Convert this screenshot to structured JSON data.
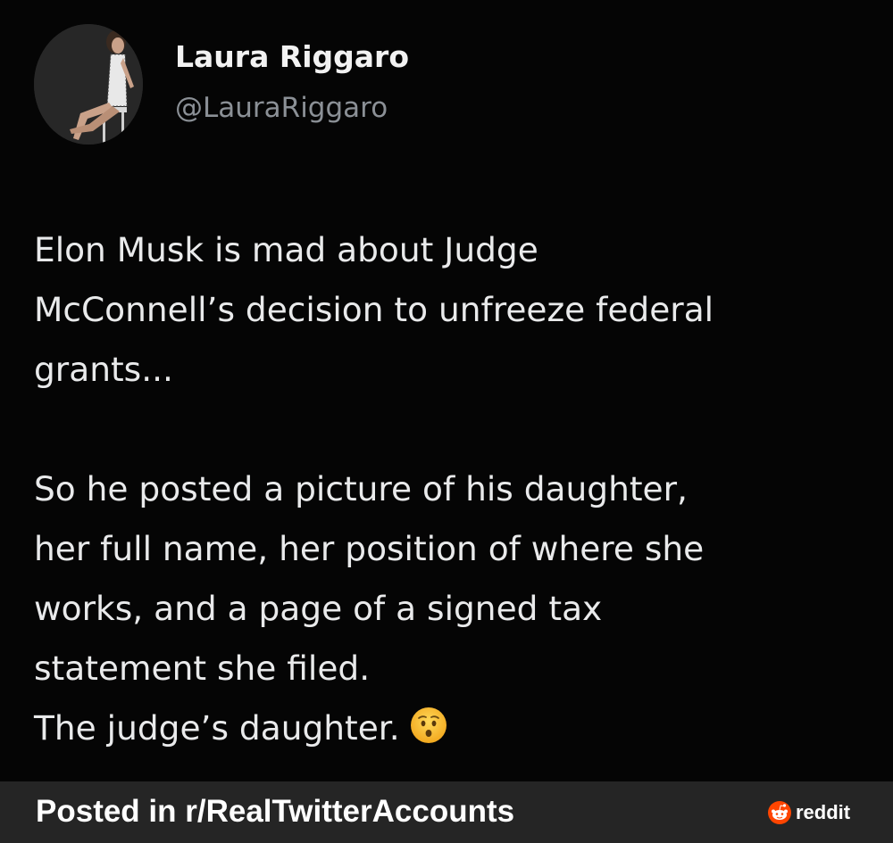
{
  "author": {
    "name": "Laura Riggaro",
    "handle": "@LauraRiggaro"
  },
  "tweet": {
    "paragraph_1": [
      "Elon Musk is mad about Judge",
      "McConnell’s decision to unfreeze federal",
      "grants..."
    ],
    "paragraph_2": [
      "So he posted a picture of his daughter,",
      "her full name, her position of where she",
      "works, and a page of a signed tax",
      "statement she filed."
    ],
    "last_line": "The judge’s daughter.",
    "emoji": "hushed-face-emoji"
  },
  "footer": {
    "posted_in": "Posted in r/RealTwitterAccounts",
    "brand": "reddit",
    "brand_icon": "reddit-snoo-icon",
    "brand_color": "#ff4500"
  },
  "colors": {
    "background": "#050505",
    "text": "#e9eaeb",
    "handle": "#8b9096",
    "footer_background": "#252525"
  }
}
